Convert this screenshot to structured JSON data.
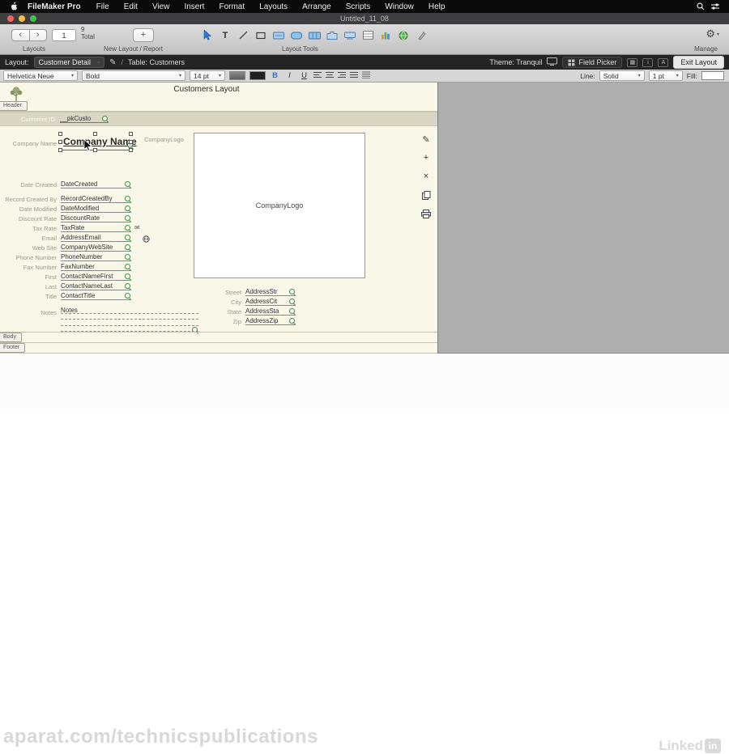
{
  "menu_bar": {
    "app_name": "FileMaker Pro",
    "items": [
      "File",
      "Edit",
      "View",
      "Insert",
      "Format",
      "Layouts",
      "Arrange",
      "Scripts",
      "Window",
      "Help"
    ]
  },
  "window": {
    "title": "Untitled_11_08"
  },
  "toolbar": {
    "layout_number": "1",
    "total_count": "9",
    "total_label": "Total",
    "layouts_label": "Layouts",
    "new_layout_label": "New Layout / Report",
    "layout_tools_label": "Layout Tools",
    "manage_label": "Manage",
    "tools": [
      "select",
      "text",
      "line",
      "rectangle",
      "field",
      "button",
      "button-bar",
      "tab-control",
      "slide-control",
      "portal",
      "chart",
      "web-viewer",
      "format-painter"
    ]
  },
  "layout_bar": {
    "layout_label": "Layout:",
    "layout_name": "Customer Detail",
    "table_label": "Table: Customers",
    "theme_label": "Theme: Tranquil",
    "field_picker_label": "Field Picker",
    "exit_layout_label": "Exit Layout"
  },
  "format_bar": {
    "font": "Helvetica Neue",
    "style": "Bold",
    "size": "14 pt",
    "bold": "B",
    "italic": "I",
    "underline": "U",
    "line_label": "Line:",
    "line_style": "Solid",
    "line_weight": "1 pt",
    "fill_label": "Fill:"
  },
  "canvas": {
    "layout_title": "Customers Layout",
    "header_tab": "Header",
    "body_tab": "Body",
    "footer_tab": "Footer",
    "header_field": {
      "label": "Customer ID",
      "field": "__pkCusto"
    },
    "selected_field": {
      "label": "Company Name",
      "field": "Company Name"
    },
    "logo": {
      "label": "CompanyLogo",
      "placeholder": "CompanyLogo"
    },
    "left_fields": [
      {
        "label": "Date Created",
        "field": "DateCreated"
      },
      {
        "label": "Record Created By",
        "field": "RecordCreatedBy"
      },
      {
        "label": "Date Modified",
        "field": "DateModified"
      },
      {
        "label": "Discount Rate",
        "field": "DiscountRate"
      },
      {
        "label": "Tax Rate",
        "field": "TaxRate"
      },
      {
        "label": "Email",
        "field": "AddressEmail"
      },
      {
        "label": "Web Site",
        "field": "CompanyWebSite"
      },
      {
        "label": "Phone Number",
        "field": "PhoneNumber"
      },
      {
        "label": "Fax Number",
        "field": "FaxNumber"
      },
      {
        "label": "First",
        "field": "ContactNameFirst"
      },
      {
        "label": "Last",
        "field": "ContactNameLast"
      },
      {
        "label": "Title",
        "field": "ContactTitle"
      }
    ],
    "notes_field": {
      "label": "Notes",
      "field": "Notes"
    },
    "address_fields": [
      {
        "label": "Street",
        "field": "AddressStr"
      },
      {
        "label": "City",
        "field": "AddressCit"
      },
      {
        "label": "State",
        "field": "AddressSta"
      },
      {
        "label": "Zip",
        "field": "AddressZip"
      }
    ]
  },
  "icons": {
    "back": "‹",
    "forward": "›",
    "plus": "+",
    "gear": "⚙",
    "pencil": "✎",
    "envelope": "✉",
    "close": "×",
    "chevron": "▾",
    "slash": "/"
  },
  "colors": {
    "canvas_bg": "#f9f7e8",
    "selection_blue": "#2f7ad3",
    "badge_green": "#3f8f3f"
  },
  "watermark": "aparat.com/technicspublications",
  "brand": {
    "linkedin_text": "Linked",
    "linkedin_badge": "in"
  }
}
